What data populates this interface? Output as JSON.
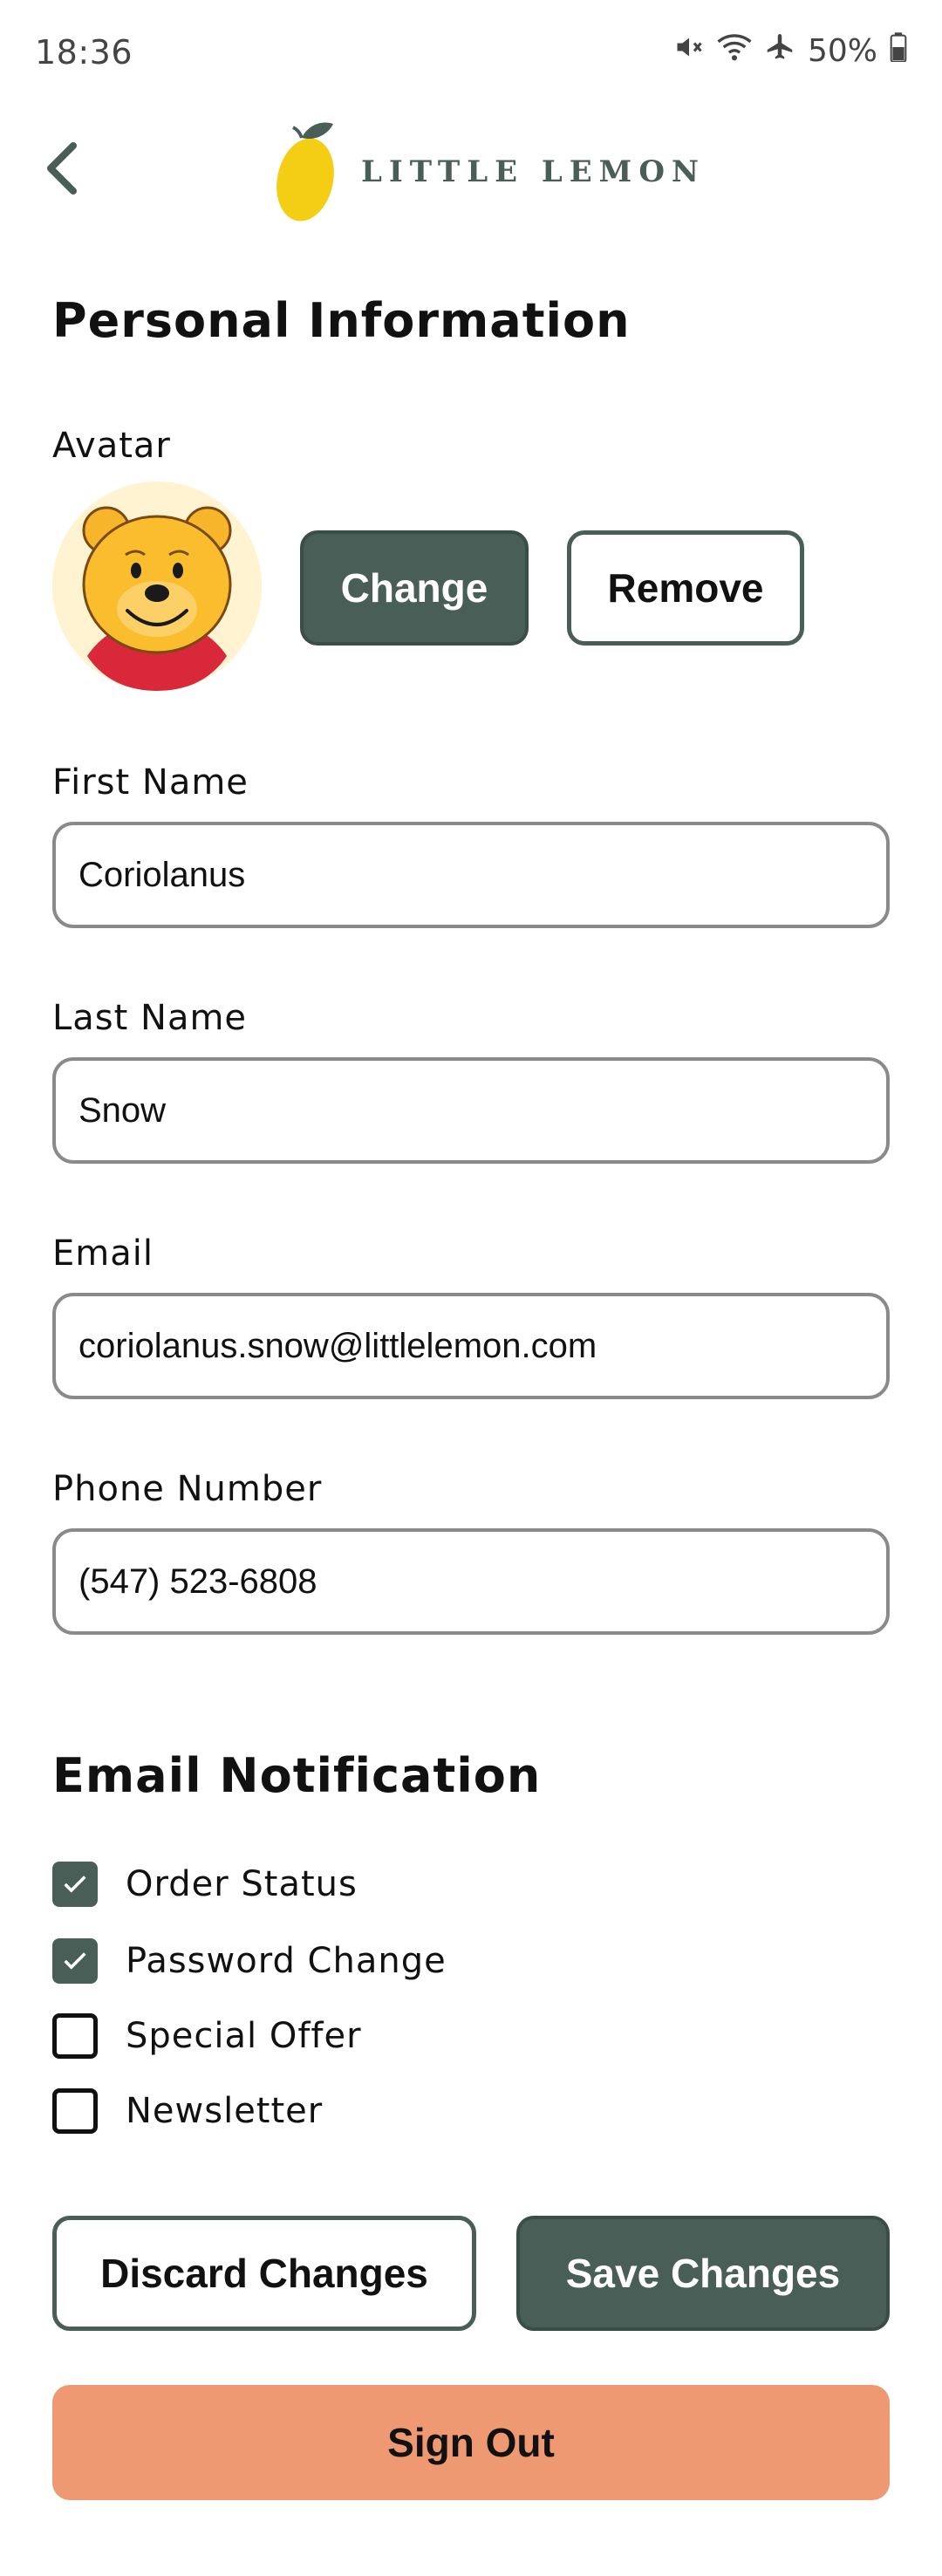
{
  "status_bar": {
    "time": "18:36",
    "battery": "50%",
    "icons": [
      "mute-icon",
      "wifi-icon",
      "airplane-icon",
      "battery-icon"
    ]
  },
  "header": {
    "logo_text": "LITTLE LEMON",
    "back_icon": "chevron-left-icon"
  },
  "personal_info": {
    "title": "Personal Information",
    "avatar_label": "Avatar",
    "change_label": "Change",
    "remove_label": "Remove",
    "fields": {
      "first_name": {
        "label": "First Name",
        "value": "Coriolanus"
      },
      "last_name": {
        "label": "Last Name",
        "value": "Snow"
      },
      "email": {
        "label": "Email",
        "value": "coriolanus.snow@littlelemon.com"
      },
      "phone": {
        "label": "Phone Number",
        "value": "(547) 523-6808"
      }
    }
  },
  "notifications": {
    "title": "Email Notification",
    "items": [
      {
        "label": "Order Status",
        "checked": true
      },
      {
        "label": "Password Change",
        "checked": true
      },
      {
        "label": "Special Offer",
        "checked": false
      },
      {
        "label": "Newsletter",
        "checked": false
      }
    ]
  },
  "actions": {
    "discard_label": "Discard Changes",
    "save_label": "Save Changes",
    "signout_label": "Sign Out"
  },
  "colors": {
    "primary": "#495e57",
    "accent": "#ee9972",
    "lemon": "#f4ce14"
  }
}
